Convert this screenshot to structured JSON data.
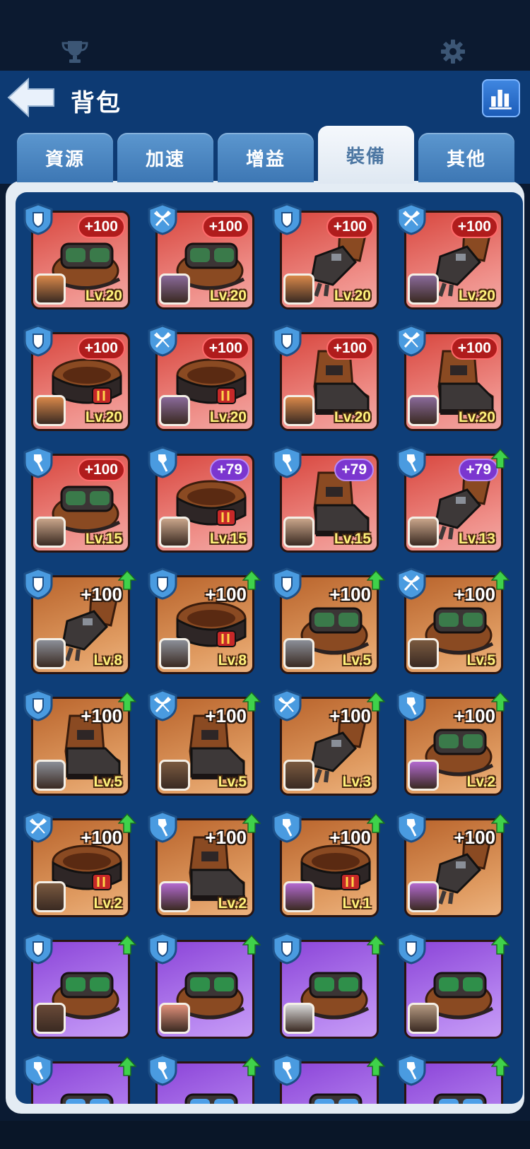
{
  "header": {
    "title": "背包"
  },
  "tabs": [
    {
      "label": "資源"
    },
    {
      "label": "加速"
    },
    {
      "label": "增益"
    },
    {
      "label": "裝備"
    },
    {
      "label": "其他"
    }
  ],
  "active_tab": "裝備",
  "colors": {
    "rarity_red": "#d8473f",
    "rarity_orange": "#b9642c",
    "rarity_purple": "#8b44d8",
    "bonus_red": "#b01c1c",
    "bonus_purple": "#7b36cf",
    "level_yellow": "#fff27a",
    "upgrade_green": "#3fd24a"
  },
  "items": [
    {
      "kind": "goggles",
      "type": "shield",
      "rarity": "red",
      "bonus": "+100",
      "bonus_style": "red-pill",
      "level": "Lv.20",
      "portrait": "#d9884a",
      "upgrade": false
    },
    {
      "kind": "goggles",
      "type": "bow",
      "rarity": "red",
      "bonus": "+100",
      "bonus_style": "red-pill",
      "level": "Lv.20",
      "portrait": "#8a6a9a",
      "upgrade": false
    },
    {
      "kind": "gauntlet",
      "type": "shield",
      "rarity": "red",
      "bonus": "+100",
      "bonus_style": "red-pill",
      "level": "Lv.20",
      "portrait": "#d9884a",
      "upgrade": false
    },
    {
      "kind": "gauntlet",
      "type": "bow",
      "rarity": "red",
      "bonus": "+100",
      "bonus_style": "red-pill",
      "level": "Lv.20",
      "portrait": "#8a6a9a",
      "upgrade": false
    },
    {
      "kind": "belt",
      "type": "shield",
      "rarity": "red",
      "bonus": "+100",
      "bonus_style": "red-pill",
      "level": "Lv.20",
      "portrait": "#d9884a",
      "upgrade": false
    },
    {
      "kind": "belt",
      "type": "bow",
      "rarity": "red",
      "bonus": "+100",
      "bonus_style": "red-pill",
      "level": "Lv.20",
      "portrait": "#8a6a9a",
      "upgrade": false
    },
    {
      "kind": "boot",
      "type": "shield",
      "rarity": "red",
      "bonus": "+100",
      "bonus_style": "red-pill",
      "level": "Lv.20",
      "portrait": "#d9884a",
      "upgrade": false
    },
    {
      "kind": "boot",
      "type": "bow",
      "rarity": "red",
      "bonus": "+100",
      "bonus_style": "red-pill",
      "level": "Lv.20",
      "portrait": "#8a6a9a",
      "upgrade": false
    },
    {
      "kind": "goggles",
      "type": "shovel",
      "rarity": "red",
      "bonus": "+100",
      "bonus_style": "red-pill",
      "level": "Lv.15",
      "portrait": "#c9a58a",
      "upgrade": false
    },
    {
      "kind": "belt",
      "type": "shovel",
      "rarity": "red",
      "bonus": "+79",
      "bonus_style": "purple-pill",
      "level": "Lv.15",
      "portrait": "#c9a58a",
      "upgrade": false
    },
    {
      "kind": "boot",
      "type": "shovel",
      "rarity": "red",
      "bonus": "+79",
      "bonus_style": "purple-pill",
      "level": "Lv.15",
      "portrait": "#c9a58a",
      "upgrade": false
    },
    {
      "kind": "gauntlet",
      "type": "shovel",
      "rarity": "red",
      "bonus": "+79",
      "bonus_style": "purple-pill",
      "level": "Lv.13",
      "portrait": "#c9a58a",
      "upgrade": true
    },
    {
      "kind": "gauntlet",
      "type": "shield",
      "rarity": "orange",
      "bonus": "+100",
      "bonus_style": "plain",
      "level": "Lv.8",
      "portrait": "#8b8f98",
      "upgrade": true
    },
    {
      "kind": "belt",
      "type": "shield",
      "rarity": "orange",
      "bonus": "+100",
      "bonus_style": "plain",
      "level": "Lv.8",
      "portrait": "#8b8f98",
      "upgrade": true
    },
    {
      "kind": "goggles",
      "type": "shield",
      "rarity": "orange",
      "bonus": "+100",
      "bonus_style": "plain",
      "level": "Lv.5",
      "portrait": "#8b8f98",
      "upgrade": true
    },
    {
      "kind": "goggles",
      "type": "bow",
      "rarity": "orange",
      "bonus": "+100",
      "bonus_style": "plain",
      "level": "Lv.5",
      "portrait": "#7a5a40",
      "upgrade": true
    },
    {
      "kind": "boot",
      "type": "shield",
      "rarity": "orange",
      "bonus": "+100",
      "bonus_style": "plain",
      "level": "Lv.5",
      "portrait": "#8b8f98",
      "upgrade": true
    },
    {
      "kind": "boot",
      "type": "bow",
      "rarity": "orange",
      "bonus": "+100",
      "bonus_style": "plain",
      "level": "Lv.5",
      "portrait": "#7a5a40",
      "upgrade": true
    },
    {
      "kind": "gauntlet",
      "type": "bow",
      "rarity": "orange",
      "bonus": "+100",
      "bonus_style": "plain",
      "level": "Lv.3",
      "portrait": "#7a5a40",
      "upgrade": true
    },
    {
      "kind": "goggles",
      "type": "shovel",
      "rarity": "orange",
      "bonus": "+100",
      "bonus_style": "plain",
      "level": "Lv.2",
      "portrait": "#b36ad0",
      "upgrade": true
    },
    {
      "kind": "belt",
      "type": "bow",
      "rarity": "orange",
      "bonus": "+100",
      "bonus_style": "plain",
      "level": "Lv.2",
      "portrait": "#7a5a40",
      "upgrade": true
    },
    {
      "kind": "boot",
      "type": "shovel",
      "rarity": "orange",
      "bonus": "+100",
      "bonus_style": "plain",
      "level": "Lv.2",
      "portrait": "#b36ad0",
      "upgrade": true
    },
    {
      "kind": "belt",
      "type": "shovel",
      "rarity": "orange",
      "bonus": "+100",
      "bonus_style": "plain",
      "level": "Lv.1",
      "portrait": "#b36ad0",
      "upgrade": true
    },
    {
      "kind": "gauntlet",
      "type": "shovel",
      "rarity": "orange",
      "bonus": "+100",
      "bonus_style": "plain",
      "level": "",
      "portrait": "#b36ad0",
      "upgrade": true
    },
    {
      "kind": "green-goggles",
      "type": "shield",
      "rarity": "purple",
      "bonus": "",
      "bonus_style": "plain",
      "level": "",
      "portrait": "#6a4a38",
      "upgrade": true
    },
    {
      "kind": "green-goggles",
      "type": "shield",
      "rarity": "purple",
      "bonus": "",
      "bonus_style": "plain",
      "level": "",
      "portrait": "#e0907a",
      "upgrade": true
    },
    {
      "kind": "green-goggles",
      "type": "shield",
      "rarity": "purple",
      "bonus": "",
      "bonus_style": "plain",
      "level": "",
      "portrait": "#d8d8d8",
      "upgrade": true
    },
    {
      "kind": "green-goggles",
      "type": "shield",
      "rarity": "purple",
      "bonus": "",
      "bonus_style": "plain",
      "level": "",
      "portrait": "#b59a82",
      "upgrade": true
    },
    {
      "kind": "blue-goggles",
      "type": "shovel",
      "rarity": "purple",
      "bonus": "",
      "bonus_style": "plain",
      "level": "",
      "portrait": "",
      "upgrade": true
    },
    {
      "kind": "blue-goggles",
      "type": "shovel",
      "rarity": "purple",
      "bonus": "",
      "bonus_style": "plain",
      "level": "",
      "portrait": "",
      "upgrade": true
    },
    {
      "kind": "blue-goggles",
      "type": "shovel",
      "rarity": "purple",
      "bonus": "",
      "bonus_style": "plain",
      "level": "",
      "portrait": "",
      "upgrade": true
    },
    {
      "kind": "blue-goggles",
      "type": "shovel",
      "rarity": "purple",
      "bonus": "",
      "bonus_style": "plain",
      "level": "",
      "portrait": "",
      "upgrade": true
    }
  ]
}
